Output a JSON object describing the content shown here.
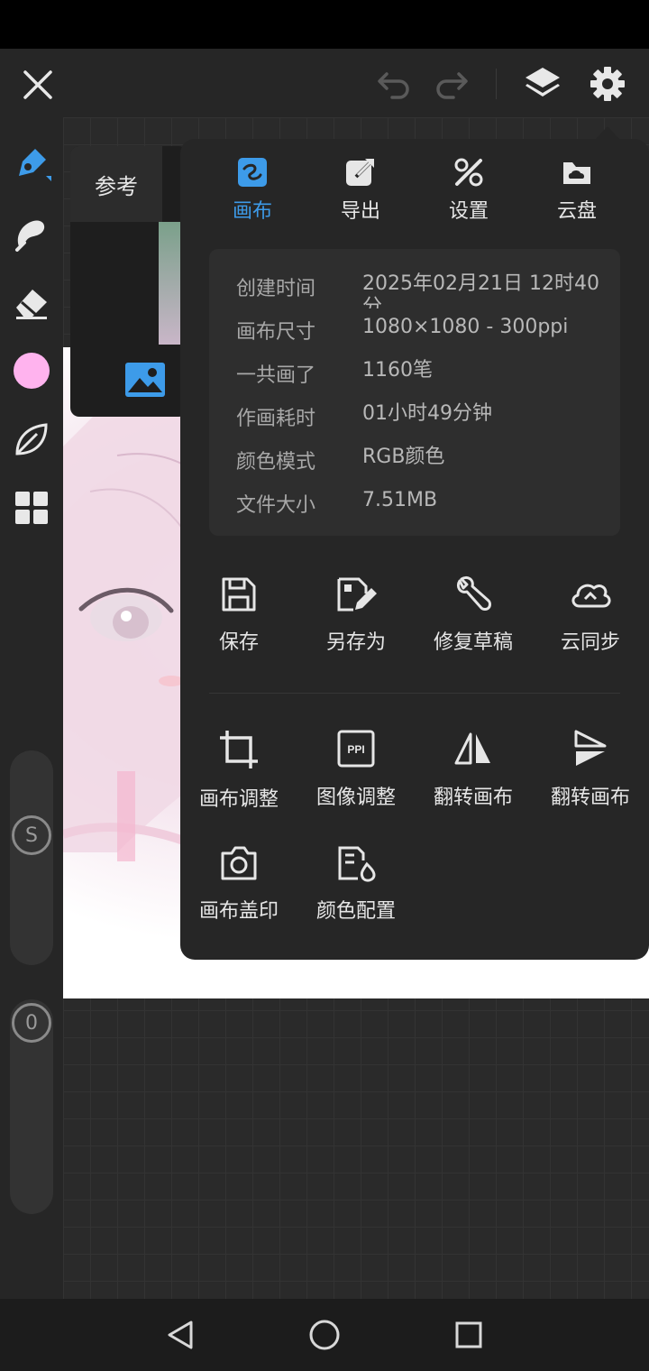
{
  "colors": {
    "accent": "#3d9be9",
    "current_color": "#ffb3ee",
    "panel_bg": "#262626"
  },
  "topbar": {
    "close_icon": "close-icon",
    "undo_icon": "undo-icon",
    "redo_icon": "redo-icon",
    "layers_icon": "layers-icon",
    "settings_icon": "gear-icon"
  },
  "sidebar": {
    "tools": [
      "pen-icon",
      "smudge-icon",
      "eraser-icon",
      "color-swatch",
      "leaf-icon",
      "grid-icon"
    ],
    "size_slider_label": "S",
    "opacity_slider_label": "0"
  },
  "reference": {
    "tab_label": "参考"
  },
  "canvas_menu": {
    "tabs": [
      {
        "label": "画布",
        "icon": "canvas-icon",
        "active": true
      },
      {
        "label": "导出",
        "icon": "export-icon",
        "active": false
      },
      {
        "label": "设置",
        "icon": "tools-icon",
        "active": false
      },
      {
        "label": "云盘",
        "icon": "cloud-disk-icon",
        "active": false
      }
    ],
    "info": [
      {
        "key": "创建时间",
        "value": "2025年02月21日 12时40分"
      },
      {
        "key": "画布尺寸",
        "value": "1080×1080 - 300ppi"
      },
      {
        "key": "一共画了",
        "value": "1160笔"
      },
      {
        "key": "作画耗时",
        "value": "01小时49分钟"
      },
      {
        "key": "颜色模式",
        "value": "RGB颜色"
      },
      {
        "key": "文件大小",
        "value": "7.51MB"
      }
    ],
    "actions_row1": [
      {
        "label": "保存",
        "icon": "save-icon"
      },
      {
        "label": "另存为",
        "icon": "save-as-icon"
      },
      {
        "label": "修复草稿",
        "icon": "wrench-icon"
      },
      {
        "label": "云同步",
        "icon": "cloud-sync-icon"
      }
    ],
    "actions_row2": [
      {
        "label": "画布调整",
        "icon": "crop-icon"
      },
      {
        "label": "图像调整",
        "icon": "ppi-icon"
      },
      {
        "label": "翻转画布",
        "icon": "flip-horizontal-icon"
      },
      {
        "label": "翻转画布",
        "icon": "flip-vertical-icon"
      }
    ],
    "actions_row3": [
      {
        "label": "画布盖印",
        "icon": "camera-icon"
      },
      {
        "label": "颜色配置",
        "icon": "color-profile-icon"
      }
    ]
  },
  "navbar": {
    "back_icon": "back-icon",
    "home_icon": "home-icon",
    "recents_icon": "recents-icon"
  }
}
